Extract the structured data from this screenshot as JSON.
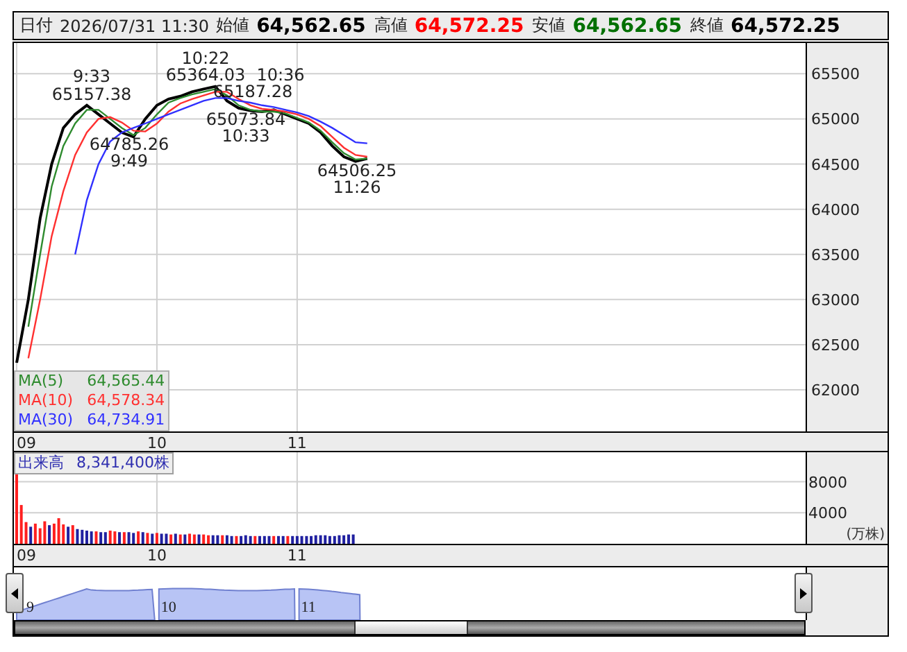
{
  "header": {
    "date_label": "日付",
    "datetime": "2026/07/31 11:30",
    "prices": [
      {
        "label": "始値",
        "value": "64,562.65",
        "color": "#000000"
      },
      {
        "label": "高値",
        "value": "64,572.25",
        "color": "#ff0000"
      },
      {
        "label": "安値",
        "value": "64,562.65",
        "color": "#007000"
      },
      {
        "label": "終値",
        "value": "64,572.25",
        "color": "#000000"
      }
    ]
  },
  "price_chart": {
    "chart_data": {
      "type": "line",
      "x": [
        9,
        9.083,
        9.167,
        9.25,
        9.333,
        9.417,
        9.5,
        9.583,
        9.667,
        9.75,
        9.833,
        9.917,
        10,
        10.083,
        10.167,
        10.25,
        10.333,
        10.417,
        10.5,
        10.583,
        10.667,
        10.75,
        10.833,
        10.917,
        11,
        11.083,
        11.167,
        11.25,
        11.333,
        11.417,
        11.5
      ],
      "xlim": [
        9,
        15.21
      ],
      "ylim": [
        61540,
        65840
      ],
      "xticks": [
        {
          "value": 9,
          "label": "09"
        },
        {
          "value": 10,
          "label": "10"
        },
        {
          "value": 11,
          "label": "11"
        }
      ],
      "yticks": [
        62000,
        62500,
        63000,
        63500,
        64000,
        64500,
        65000,
        65500
      ],
      "series": [
        {
          "color": "#000000",
          "values": [
            62300,
            63000,
            63900,
            64500,
            64900,
            65050,
            65150,
            65050,
            64950,
            64850,
            64800,
            65000,
            65150,
            65220,
            65250,
            65300,
            65330,
            65360,
            65200,
            65120,
            65090,
            65080,
            65100,
            65050,
            65000,
            64950,
            64850,
            64700,
            64580,
            64530,
            64560
          ]
        },
        {
          "name": "MA(5)",
          "color": "#2e8b2e",
          "values": [
            null,
            62700,
            63500,
            64250,
            64700,
            64950,
            65100,
            65100,
            65000,
            64900,
            64820,
            64900,
            65050,
            65180,
            65230,
            65270,
            65300,
            65330,
            65260,
            65150,
            65100,
            65080,
            65080,
            65060,
            65010,
            64960,
            64870,
            64740,
            64620,
            64550,
            64560
          ]
        },
        {
          "name": "MA(10)",
          "color": "#ff3030",
          "values": [
            null,
            62350,
            63000,
            63700,
            64200,
            64600,
            64850,
            65000,
            65020,
            64960,
            64870,
            64860,
            64950,
            65080,
            65170,
            65220,
            65260,
            65300,
            65300,
            65220,
            65150,
            65110,
            65100,
            65080,
            65050,
            65000,
            64920,
            64800,
            64680,
            64600,
            64580
          ]
        },
        {
          "name": "MA(30)",
          "color": "#3030ff",
          "values": [
            null,
            null,
            null,
            null,
            null,
            63500,
            64100,
            64500,
            64750,
            64850,
            64900,
            64950,
            65000,
            65050,
            65100,
            65150,
            65200,
            65230,
            65230,
            65200,
            65180,
            65150,
            65130,
            65100,
            65070,
            65030,
            64970,
            64900,
            64820,
            64740,
            64730
          ]
        }
      ],
      "grid": true,
      "annotations": [
        "9:33",
        "65157.38",
        "64785.26",
        "9:49",
        "10:22",
        "65364.03",
        "10:36",
        "65187.28",
        "65073.84",
        "10:33",
        "64506.25",
        "11:26"
      ]
    },
    "legend": [
      {
        "value": "64,565.44"
      },
      {
        "value": "64,578.34"
      },
      {
        "value": "64,734.91"
      }
    ]
  },
  "volume_chart": {
    "legend": {
      "label": "出来高",
      "value": "8,341,400株"
    },
    "chart_data": {
      "type": "bar",
      "stacked": true,
      "grid": true,
      "ylabel": "(万株)",
      "xlim": [
        9,
        15.21
      ],
      "ylim": [
        0,
        11800
      ],
      "x": [
        9,
        9.033,
        9.067,
        9.1,
        9.133,
        9.167,
        9.2,
        9.233,
        9.267,
        9.3,
        9.333,
        9.367,
        9.4,
        9.433,
        9.467,
        9.5,
        9.533,
        9.567,
        9.6,
        9.633,
        9.667,
        9.7,
        9.733,
        9.767,
        9.8,
        9.833,
        9.867,
        9.9,
        9.933,
        9.967,
        10,
        10.033,
        10.067,
        10.1,
        10.133,
        10.167,
        10.2,
        10.233,
        10.267,
        10.3,
        10.333,
        10.367,
        10.4,
        10.433,
        10.467,
        10.5,
        10.533,
        10.567,
        10.6,
        10.633,
        10.667,
        10.7,
        10.733,
        10.767,
        10.8,
        10.833,
        10.867,
        10.9,
        10.933,
        10.967,
        11,
        11.033,
        11.067,
        11.1,
        11.133,
        11.167,
        11.2,
        11.233,
        11.267,
        11.3,
        11.333,
        11.367,
        11.4
      ],
      "xticks": [
        {
          "value": 9,
          "label": "09"
        },
        {
          "value": 10,
          "label": "10"
        },
        {
          "value": 11,
          "label": "11"
        }
      ],
      "yticks": [
        4000,
        8000
      ],
      "series": [
        {
          "color": "#ff2020",
          "values": [
            9000,
            5000,
            2800,
            null,
            2600,
            2000,
            2900,
            null,
            2600,
            3300,
            2500,
            null,
            2400,
            null,
            null,
            null,
            null,
            1600,
            null,
            null,
            1700,
            1600,
            null,
            1500,
            null,
            null,
            1600,
            null,
            1400,
            null,
            1400,
            null,
            null,
            1200,
            null,
            1200,
            null,
            1300,
            1200,
            null,
            1200,
            1100,
            null,
            null,
            1100,
            null,
            null,
            1000,
            null,
            null,
            null,
            1000,
            null,
            null,
            null,
            1000,
            null,
            null,
            1000,
            null,
            null,
            null,
            null,
            null,
            null,
            null,
            null,
            null,
            null,
            null,
            null,
            null,
            null
          ]
        },
        {
          "color": "#2020a0",
          "values": [
            null,
            null,
            null,
            2200,
            null,
            null,
            null,
            2400,
            null,
            null,
            null,
            2200,
            null,
            1900,
            1800,
            1700,
            1600,
            null,
            1500,
            1500,
            null,
            null,
            1500,
            null,
            1500,
            1400,
            null,
            1500,
            null,
            1300,
            null,
            1300,
            1300,
            null,
            1300,
            null,
            1200,
            null,
            null,
            1200,
            null,
            null,
            1100,
            1100,
            null,
            1100,
            1000,
            null,
            1000,
            1100,
            1000,
            null,
            1000,
            1000,
            1000,
            null,
            1000,
            1000,
            null,
            1000,
            1000,
            1000,
            1000,
            1000,
            1100,
            1100,
            1100,
            1000,
            1000,
            1100,
            1100,
            1200,
            1200
          ]
        }
      ]
    }
  },
  "navigator": {
    "labels": [
      "9",
      "10",
      "11"
    ]
  }
}
